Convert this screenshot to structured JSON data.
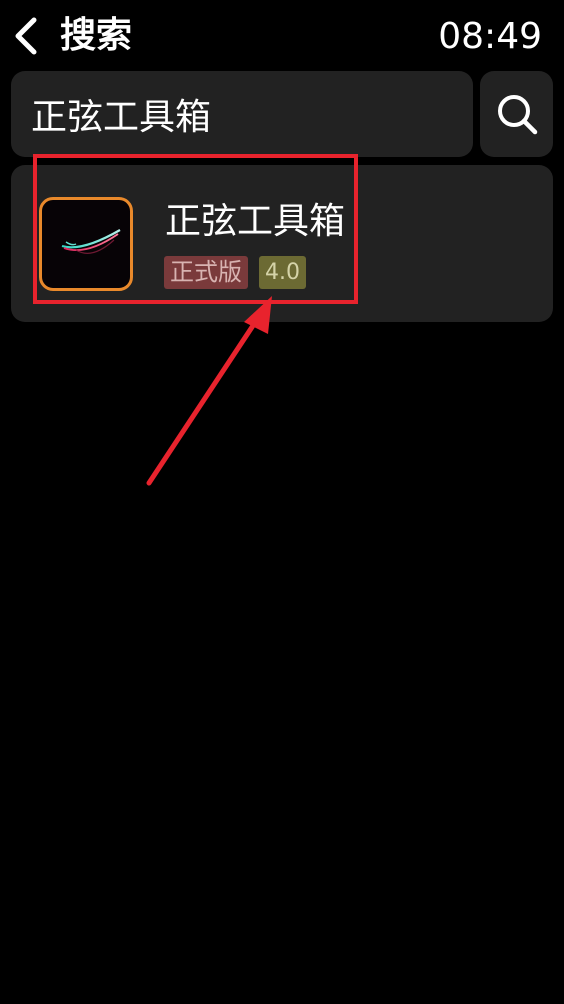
{
  "header": {
    "back_icon": "chevron-left-icon",
    "title": "搜索",
    "time": "08:49"
  },
  "search": {
    "query": "正弦工具箱",
    "button_icon": "search-icon"
  },
  "results": [
    {
      "name": "正弦工具箱",
      "edition": "正式版",
      "version": "4.0",
      "icon": "app-logo-icon"
    }
  ],
  "colors": {
    "background": "#000000",
    "card": "#222222",
    "icon_border": "#e9892b",
    "edition_badge": "#7a3a3b",
    "version_badge": "#6c6a33",
    "annotation": "#e8232d"
  }
}
